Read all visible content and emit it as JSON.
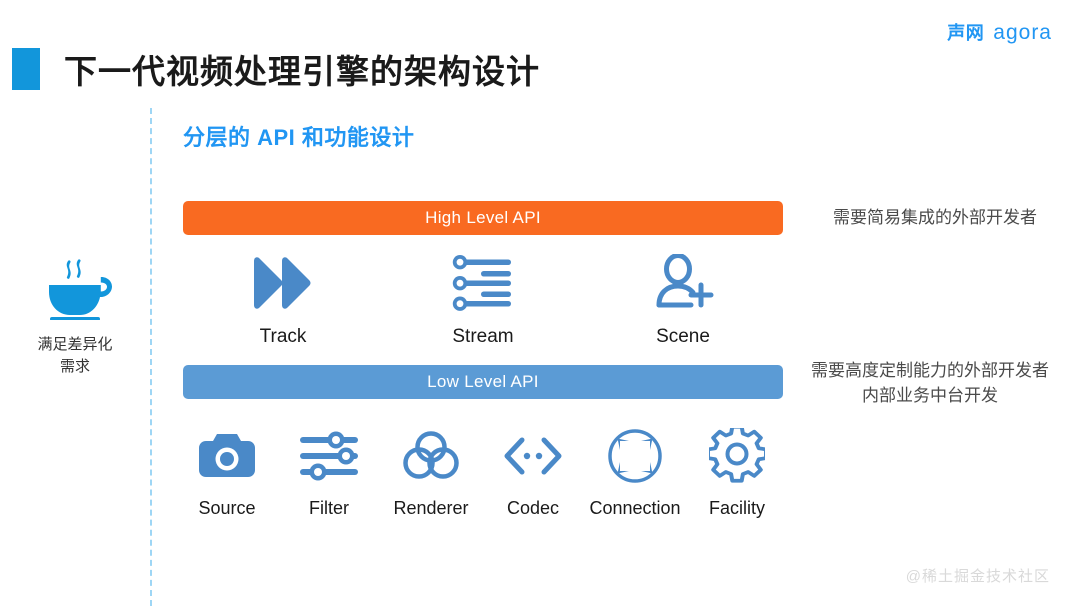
{
  "header": {
    "logo_cn": "声网",
    "logo_en": "agora",
    "title": "下一代视频处理引擎的架构设计"
  },
  "section": {
    "subtitle": "分层的 API 和功能设计"
  },
  "aside": {
    "icon": "coffee-cup-icon",
    "label_line1": "满足差异化",
    "label_line2": "需求"
  },
  "layers": {
    "high": {
      "bar_label": "High Level API",
      "bar_color": "#F96A21",
      "note": "需要简易集成的外部开发者",
      "items": [
        {
          "label": "Track",
          "icon": "fast-forward-icon"
        },
        {
          "label": "Stream",
          "icon": "stream-lines-icon"
        },
        {
          "label": "Scene",
          "icon": "add-person-icon"
        }
      ]
    },
    "low": {
      "bar_label": "Low Level API",
      "bar_color": "#5B9BD5",
      "note_line1": "需要高度定制能力的外部开发者",
      "note_line2": "内部业务中台开发",
      "items": [
        {
          "label": "Source",
          "icon": "camera-icon"
        },
        {
          "label": "Filter",
          "icon": "sliders-icon"
        },
        {
          "label": "Renderer",
          "icon": "three-circles-icon"
        },
        {
          "label": "Codec",
          "icon": "code-brackets-icon"
        },
        {
          "label": "Connection",
          "icon": "four-arrows-circle-icon"
        },
        {
          "label": "Facility",
          "icon": "gear-icon"
        }
      ]
    }
  },
  "watermark": "@稀土掘金技术社区",
  "colors": {
    "brand_blue": "#2196F3",
    "title_mark": "#1296DB",
    "icon_blue": "#4A89C8",
    "dashed_line": "#9ed6f5"
  }
}
